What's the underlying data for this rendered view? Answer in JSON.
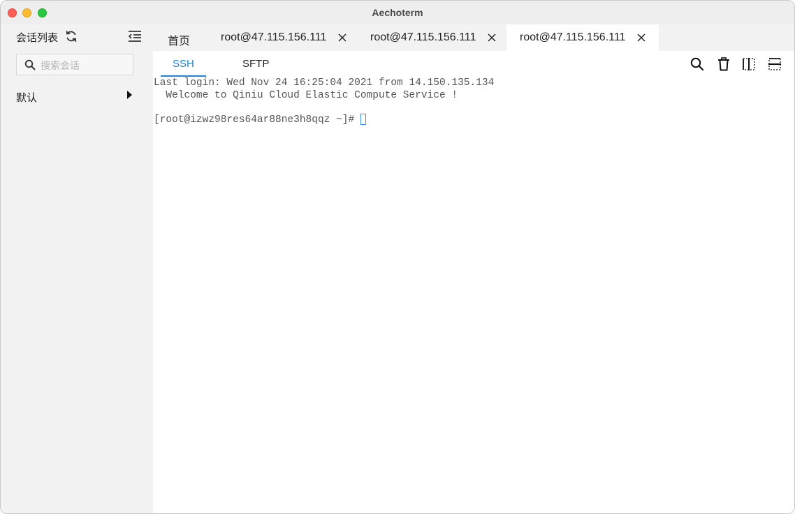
{
  "window": {
    "title": "Aechoterm"
  },
  "sidebar": {
    "title": "会话列表",
    "search_placeholder": "搜索会话",
    "groups": [
      {
        "label": "默认"
      }
    ]
  },
  "tabs": {
    "home_label": "首页",
    "sessions": [
      {
        "label": "root@47.115.156.111",
        "active": false
      },
      {
        "label": "root@47.115.156.111",
        "active": false
      },
      {
        "label": "root@47.115.156.111",
        "active": true
      }
    ]
  },
  "subtabs": {
    "ssh": "SSH",
    "sftp": "SFTP",
    "active": "SSH"
  },
  "toolbar": {
    "icons": [
      "search-icon",
      "trash-icon",
      "split-vertical-icon",
      "split-horizontal-icon"
    ]
  },
  "terminal": {
    "lines": [
      "Last login: Wed Nov 24 16:25:04 2021 from 14.150.135.134",
      "  Welcome to Qiniu Cloud Elastic Compute Service !",
      "",
      "[root@izwz98res64ar88ne3h8qqz ~]# "
    ]
  },
  "colors": {
    "accent": "#1f86d9",
    "sidebar_bg": "#f2f2f2",
    "titlebar_bg": "#eeeeee",
    "terminal_text": "#555555"
  }
}
